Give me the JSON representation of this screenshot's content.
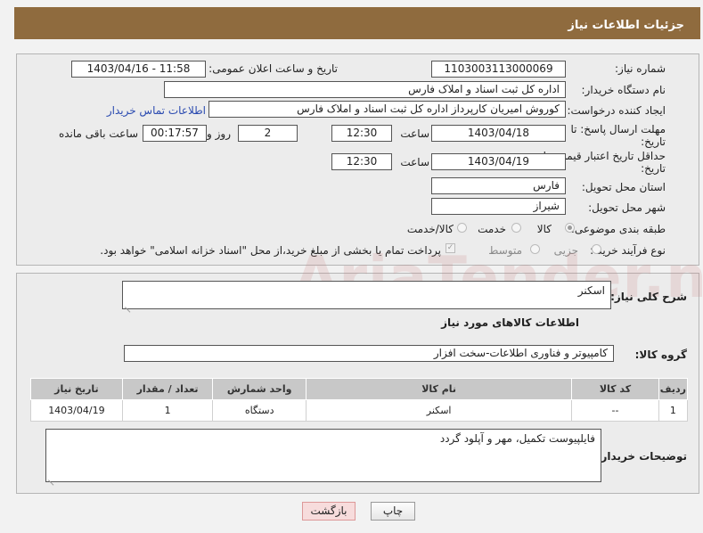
{
  "header": {
    "title": "جزئیات اطلاعات نیاز"
  },
  "form": {
    "need_number_label": "شماره نیاز:",
    "need_number": "1103003113000069",
    "announce_label": "تاریخ و ساعت اعلان عمومی:",
    "announce_value": "1403/04/16 - 11:58",
    "buyer_org_label": "نام دستگاه خریدار:",
    "buyer_org": "اداره کل ثبت اسناد و املاک فارس",
    "creator_label": "ایجاد کننده درخواست:",
    "creator": "کوروش امیریان کارپرداز اداره کل ثبت اسناد و املاک فارس",
    "contact_link": "اطلاعات تماس خریدار",
    "deadline_label": "مهلت ارسال پاسخ: تا تاریخ:",
    "deadline_date": "1403/04/18",
    "time_label": "ساعت",
    "deadline_time": "12:30",
    "days_value": "2",
    "days_label": "روز و",
    "remaining_time": "00:17:57",
    "remaining_label": "ساعت باقی مانده",
    "price_valid_label": "حداقل تاریخ اعتبار قیمت: تا تاریخ:",
    "price_valid_date": "1403/04/19",
    "price_valid_time": "12:30",
    "province_label": "استان محل تحویل:",
    "province": "فارس",
    "city_label": "شهر محل تحویل:",
    "city": "شیراز",
    "category_label": "طبقه بندی موضوعی:",
    "category_options": [
      "کالا",
      "خدمت",
      "کالا/خدمت"
    ],
    "process_label": "نوع فرآیند خرید :",
    "process_options": [
      "جزیی",
      "متوسط"
    ],
    "payment_note": "پرداخت تمام یا بخشی از مبلغ خرید،از محل \"اسناد خزانه اسلامی\" خواهد بود."
  },
  "details": {
    "desc_label": "شرح کلی نیاز:",
    "desc_value": "اسکنر",
    "items_heading": "اطلاعات کالاهای مورد نیاز",
    "group_label": "گروه کالا:",
    "group_value": "کامپیوتر و فناوری اطلاعات-سخت افزار",
    "table": {
      "headers": [
        "ردیف",
        "کد کالا",
        "نام کالا",
        "واحد شمارش",
        "تعداد / مقدار",
        "تاریخ نیاز"
      ],
      "rows": [
        [
          "1",
          "--",
          "اسکنر",
          "دستگاه",
          "1",
          "1403/04/19"
        ]
      ]
    },
    "buyer_notes_label": "توضیحات خریدار:",
    "buyer_notes": "فایلپیوست تکمیل، مهر و آپلود گردد"
  },
  "buttons": {
    "print": "چاپ",
    "back": "بازگشت"
  }
}
